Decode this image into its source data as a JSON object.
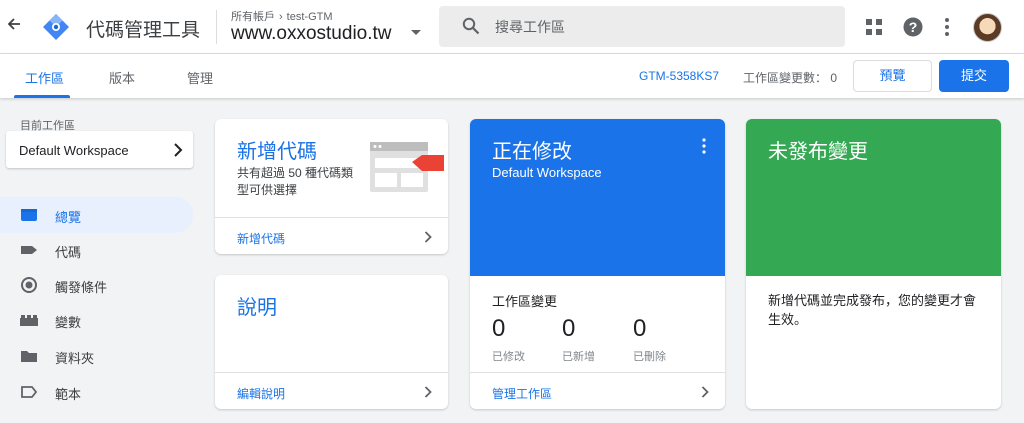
{
  "header": {
    "app_title": "代碼管理工具",
    "account_crumb": "所有帳戶",
    "account_name": "test-GTM",
    "container_name": "www.oxxostudio.tw",
    "search_placeholder": "搜尋工作區",
    "icons": [
      "back-arrow-icon",
      "gtm-logo-icon",
      "search-icon",
      "apps-grid-icon",
      "help-icon",
      "more-vert-icon"
    ]
  },
  "tabs": {
    "items": [
      {
        "label": "工作區",
        "active": true
      },
      {
        "label": "版本",
        "active": false
      },
      {
        "label": "管理",
        "active": false
      }
    ],
    "container_id": "GTM-5358KS7",
    "workspace_changes": "工作區變更數： 0",
    "preview_label": "預覽",
    "submit_label": "提交"
  },
  "sidebar": {
    "current_workspace_label": "目前工作區",
    "workspace_name": "Default Workspace",
    "items": [
      {
        "label": "總覽",
        "icon": "overview-icon",
        "active": true
      },
      {
        "label": "代碼",
        "icon": "tag-icon",
        "active": false
      },
      {
        "label": "觸發條件",
        "icon": "trigger-icon",
        "active": false
      },
      {
        "label": "變數",
        "icon": "variables-icon",
        "active": false
      },
      {
        "label": "資料夾",
        "icon": "folder-icon",
        "active": false
      },
      {
        "label": "範本",
        "icon": "template-icon",
        "active": false
      }
    ]
  },
  "cards": {
    "new_tag": {
      "title": "新增代碼",
      "description": "共有超過 50 種代碼類型可供選擇",
      "link": "新增代碼"
    },
    "help": {
      "title": "說明",
      "link": "編輯說明"
    },
    "editing": {
      "title": "正在修改",
      "subtitle": "Default Workspace",
      "section": "工作區變更",
      "stats": [
        {
          "value": "0",
          "label": "已修改"
        },
        {
          "value": "0",
          "label": "已新增"
        },
        {
          "value": "0",
          "label": "已刪除"
        }
      ],
      "link": "管理工作區"
    },
    "unpublished": {
      "title": "未發布變更",
      "description": "新增代碼並完成發布，您的變更才會生效。"
    }
  },
  "colors": {
    "accent_blue": "#1a73e8",
    "publish_green": "#34a853",
    "background": "#f1f3f4"
  }
}
